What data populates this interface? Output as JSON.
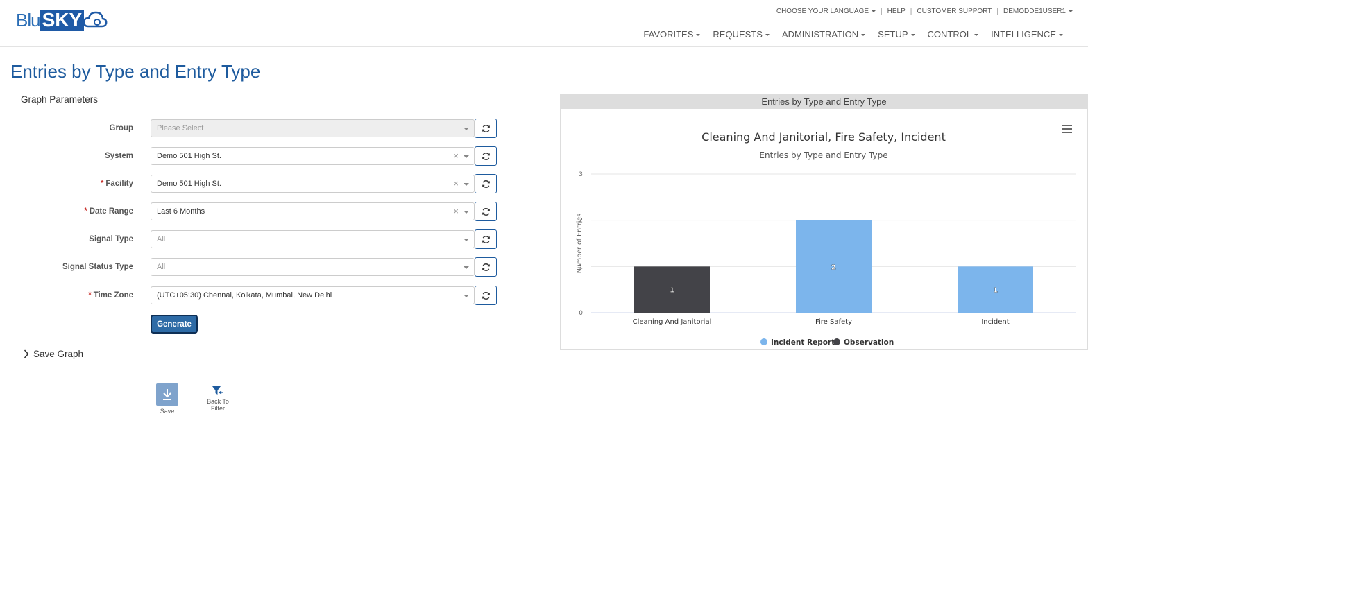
{
  "brand": {
    "logo_left": "Blu",
    "logo_right": "SKY"
  },
  "top_links": {
    "language": "CHOOSE YOUR LANGUAGE",
    "help": "HELP",
    "support": "CUSTOMER SUPPORT",
    "user": "DEMODDE1USER1",
    "sep": "|"
  },
  "main_nav": [
    "FAVORITES",
    "REQUESTS",
    "ADMINISTRATION",
    "SETUP",
    "CONTROL",
    "INTELLIGENCE"
  ],
  "page": {
    "title": "Entries by Type and Entry Type"
  },
  "params": {
    "heading": "Graph Parameters",
    "fields": [
      {
        "label": "Group",
        "required": false,
        "value": "Please Select",
        "state": "disabled",
        "clearable": false
      },
      {
        "label": "System",
        "required": false,
        "value": "Demo 501 High St.",
        "state": "filled",
        "clearable": true
      },
      {
        "label": "Facility",
        "required": true,
        "value": "Demo 501 High St.",
        "state": "filled",
        "clearable": true
      },
      {
        "label": "Date Range",
        "required": true,
        "value": "Last 6 Months",
        "state": "filled",
        "clearable": true
      },
      {
        "label": "Signal Type",
        "required": false,
        "value": "All",
        "state": "placeholder",
        "clearable": false
      },
      {
        "label": "Signal Status Type",
        "required": false,
        "value": "All",
        "state": "placeholder",
        "clearable": false
      },
      {
        "label": "Time Zone",
        "required": true,
        "value": "(UTC+05:30) Chennai, Kolkata, Mumbai, New Delhi",
        "state": "filled",
        "clearable": false
      }
    ],
    "required_mark": "*",
    "clear_glyph": "×",
    "generate_label": "Generate"
  },
  "save_graph": {
    "label": "Save Graph"
  },
  "tools": {
    "save_label": "Save",
    "back_label": "Back To Filter"
  },
  "chart_panel": {
    "header": "Entries by Type and Entry Type"
  },
  "colors": {
    "incident_report": "#7cb5ec",
    "observation": "#434348",
    "brand": "#1e5b9e"
  },
  "chart_data": {
    "type": "bar",
    "title": "Cleaning And Janitorial, Fire Safety, Incident",
    "subtitle": "Entries by Type and Entry Type",
    "ylabel": "Number of Entries",
    "xlabel": "",
    "ylim": [
      0,
      3
    ],
    "yticks": [
      0,
      1,
      2,
      3
    ],
    "categories": [
      "Cleaning And Janitorial",
      "Fire Safety",
      "Incident"
    ],
    "bars": [
      {
        "category": "Cleaning And Janitorial",
        "series": "Observation",
        "value": 1
      },
      {
        "category": "Fire Safety",
        "series": "Incident Report",
        "value": 2
      },
      {
        "category": "Incident",
        "series": "Incident Report",
        "value": 1
      }
    ],
    "legend": [
      "Incident Report",
      "Observation"
    ],
    "legend_position": "bottom-center",
    "grid": true
  }
}
